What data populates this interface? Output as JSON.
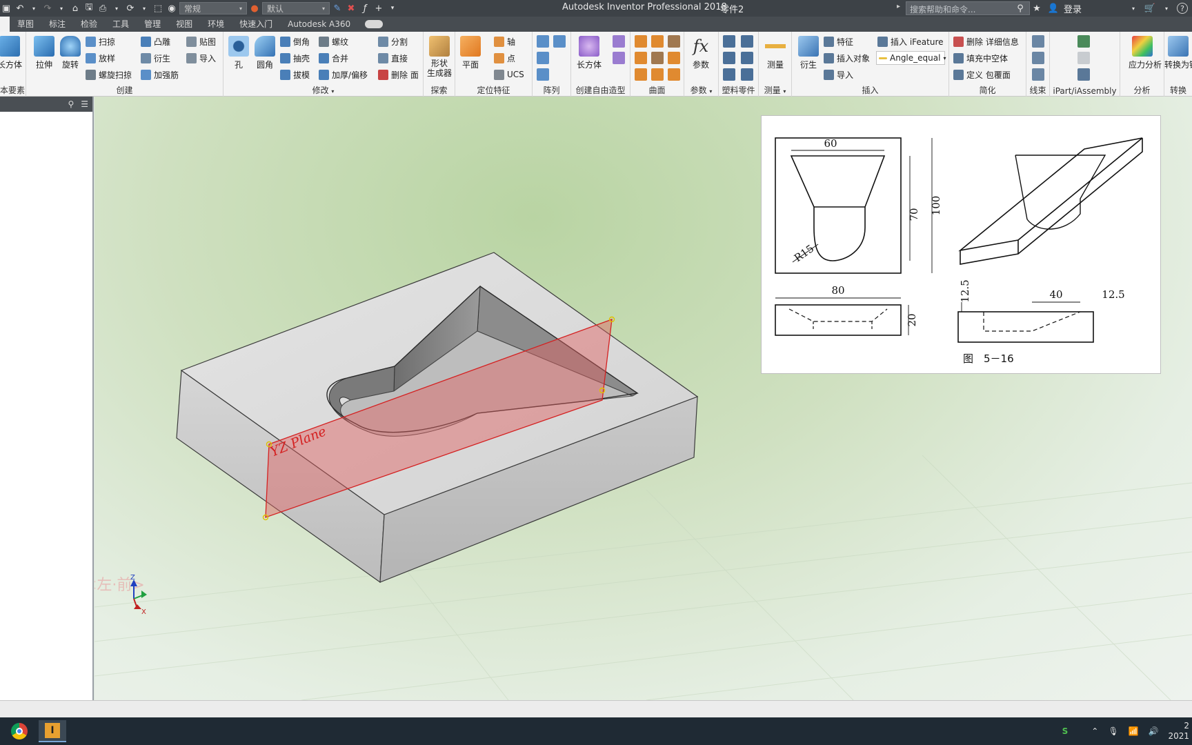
{
  "titlebar": {
    "style_combo": "常规",
    "appearance_combo": "默认",
    "app_title": "Autodesk Inventor Professional 2018",
    "doc_title": "零件2",
    "search_placeholder": "搜索帮助和命令...",
    "login_label": "登录"
  },
  "tabs": [
    "草图",
    "标注",
    "检验",
    "工具",
    "管理",
    "视图",
    "环境",
    "快速入门",
    "Autodesk A360"
  ],
  "ribbon": {
    "create": {
      "label": "创建",
      "big": [
        "拉伸",
        "旋转"
      ],
      "col1": [
        "扫掠",
        "放样",
        "螺旋扫掠"
      ],
      "col2": [
        "凸雕",
        "衍生",
        "加强筋"
      ],
      "col3": [
        "贴图",
        "导入"
      ]
    },
    "base_features": {
      "big": "长方体",
      "label": "本要素"
    },
    "modify": {
      "label": "修改",
      "big": [
        "孔",
        "圆角"
      ],
      "col1": [
        "倒角",
        "抽壳",
        "拔模"
      ],
      "col2": [
        "螺纹",
        "合并",
        "加厚/偏移"
      ],
      "col3": [
        "分割",
        "直接",
        "删除 面"
      ]
    },
    "explore": {
      "label": "探索",
      "big": "形状\n生成器"
    },
    "work_features": {
      "label": "定位特征",
      "big": "平面",
      "items": [
        "轴",
        "点",
        "UCS"
      ]
    },
    "pattern": {
      "label": "阵列"
    },
    "freeform": {
      "label": "创建自由造型",
      "big": "长方体"
    },
    "surface": {
      "label": "曲面"
    },
    "parameters": {
      "label": "参数",
      "big": "参数"
    },
    "plastic": {
      "label": "塑料零件"
    },
    "measure": {
      "label": "测量",
      "big": "测量"
    },
    "insert": {
      "label": "插入",
      "big": "衍生",
      "items": [
        "特征",
        "插入对象",
        "导入"
      ],
      "ifeature": "插入 iFeature",
      "combo": "Angle_equal"
    },
    "simplify": {
      "label": "简化",
      "items": [
        "删除 详细信息",
        "填充中空体",
        "定义 包覆面"
      ]
    },
    "harness": {
      "label": "线束"
    },
    "ipart": {
      "label": "iPart/iAssembly"
    },
    "analysis": {
      "label": "分析",
      "big": "应力分析"
    },
    "convert": {
      "big": "转换为钣",
      "label": "转换"
    }
  },
  "viewport": {
    "plane_label": "YZ Plane",
    "watermark": "<左·前>"
  },
  "reference_drawing": {
    "dims": [
      "60",
      "70",
      "100",
      "R15",
      "80",
      "20",
      "12.5",
      "40",
      "12.5"
    ],
    "caption": "图　5－16"
  },
  "taskbar": {
    "clock_time": "2",
    "clock_date": "2021"
  },
  "colors": {
    "titlebar": "#3d4247",
    "plane_fill": "#e06060",
    "plane_edge": "#d42020",
    "taskbar": "#1f2a34"
  }
}
